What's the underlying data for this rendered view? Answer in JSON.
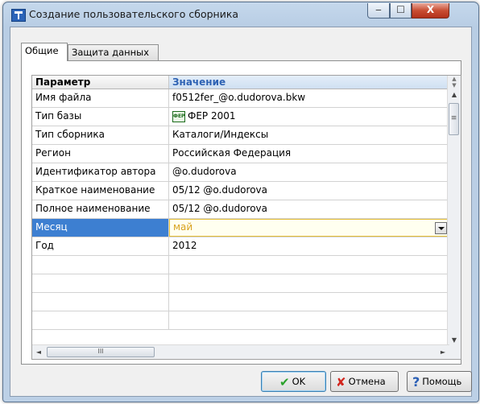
{
  "window": {
    "title": "Создание пользовательского сборника",
    "controls": {
      "minimize": "‒",
      "maximize": "☐",
      "close": "X"
    }
  },
  "tabs": [
    {
      "label": "Общие",
      "active": true
    },
    {
      "label": "Защита данных",
      "active": false
    }
  ],
  "grid": {
    "columns": {
      "param": "Параметр",
      "value": "Значение"
    },
    "rows": [
      {
        "param": "Имя файла",
        "value": "f0512fer_@o.dudorova.bkw"
      },
      {
        "param": "Тип базы",
        "value": "ФЕР 2001",
        "icon": "fer-database-icon",
        "icon_text": "ФЕР"
      },
      {
        "param": "Тип сборника",
        "value": "Каталоги/Индексы"
      },
      {
        "param": "Регион",
        "value": "Российская Федерация"
      },
      {
        "param": "Идентификатор автора",
        "value": "@o.dudorova"
      },
      {
        "param": "Краткое наименование",
        "value": "05/12 @o.dudorova"
      },
      {
        "param": "Полное наименование",
        "value": "05/12 @o.dudorova"
      },
      {
        "param": "Месяц",
        "value": "май",
        "selected": true,
        "dropdown": true
      },
      {
        "param": "Год",
        "value": "2012"
      }
    ],
    "empty_rows": 4
  },
  "scrollbars": {
    "h_thumb_grip": "III",
    "v_thumb_grip": "≡",
    "left": "◄",
    "right": "►",
    "up": "▲",
    "down": "▼"
  },
  "buttons": {
    "ok": "OK",
    "cancel": "Отмена",
    "help": "Помощь"
  },
  "colors": {
    "selected_row": "#3d7fd1",
    "value_header_text": "#2f63b4",
    "ok_icon": "#2aa12a",
    "cancel_icon": "#d2261e",
    "help_icon": "#2b5fb5"
  }
}
